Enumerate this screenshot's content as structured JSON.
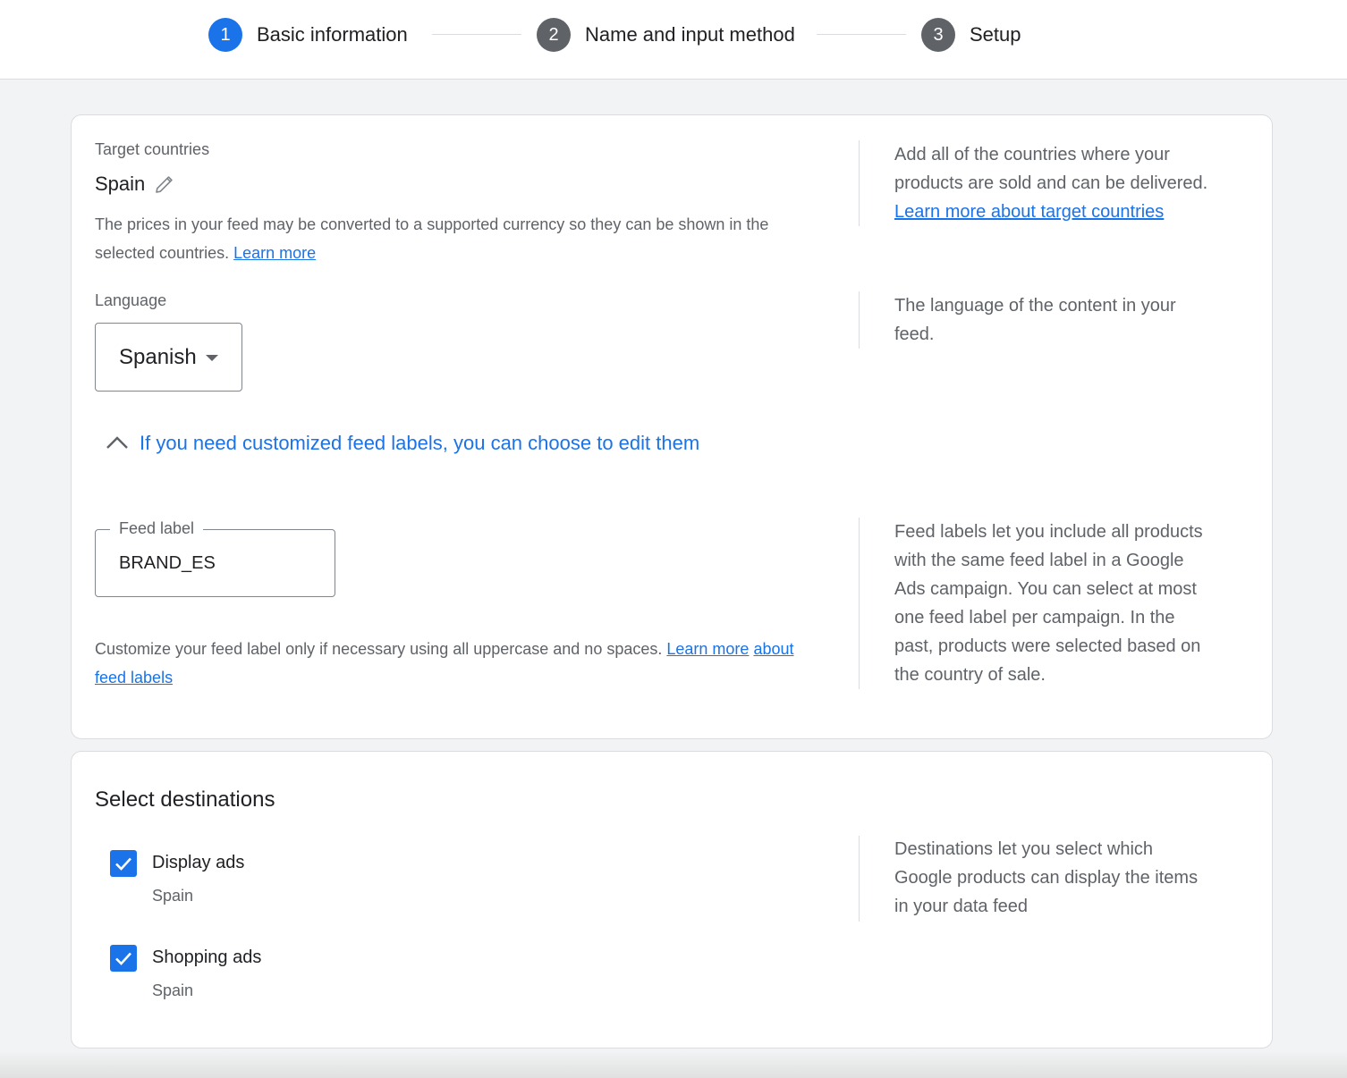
{
  "stepper": {
    "steps": [
      {
        "number": "1",
        "label": "Basic information"
      },
      {
        "number": "2",
        "label": "Name and input method"
      },
      {
        "number": "3",
        "label": "Setup"
      }
    ]
  },
  "basic_info": {
    "target_countries": {
      "label": "Target countries",
      "value": "Spain",
      "note": "The prices in your feed may be converted to a supported currency so they can be shown in the",
      "note_line2": "selected countries.",
      "note_link": "Learn more",
      "help_line1": "Add all of the countries where your",
      "help_line2": "products are sold and can be delivered.",
      "help_link": "Learn more about target countries"
    },
    "language": {
      "label": "Language",
      "selected": "Spanish",
      "help_line1": "The language of the content in your",
      "help_line2": "feed."
    },
    "feed_labels_toggle": "If you need customized feed labels, you can choose to edit them",
    "feed_label": {
      "legend": "Feed label",
      "value": "BRAND_ES",
      "note": "Customize your feed label only if necessary using all uppercase and no spaces.",
      "note_link_part1": "Learn more",
      "note_link_part2": "about feed labels",
      "help_lines": [
        "Feed labels let you include all products",
        "with the same feed label in a Google",
        "Ads campaign. You can select at most",
        "one feed label per campaign. In the",
        "past, products were selected based on",
        "the country of sale."
      ]
    }
  },
  "destinations": {
    "title": "Select destinations",
    "items": [
      {
        "label": "Display ads",
        "country": "Spain",
        "checked": true
      },
      {
        "label": "Shopping ads",
        "country": "Spain",
        "checked": true
      }
    ],
    "help_lines": [
      "Destinations let you select which",
      "Google products can display the items",
      "in your data feed"
    ]
  },
  "colors": {
    "accent": "#1a73e8",
    "step_inactive": "#5f6368",
    "background": "#f1f3f4"
  },
  "icons": [
    "pencil-icon",
    "caret-down-icon",
    "chevron-up-icon",
    "checkmark-icon"
  ]
}
